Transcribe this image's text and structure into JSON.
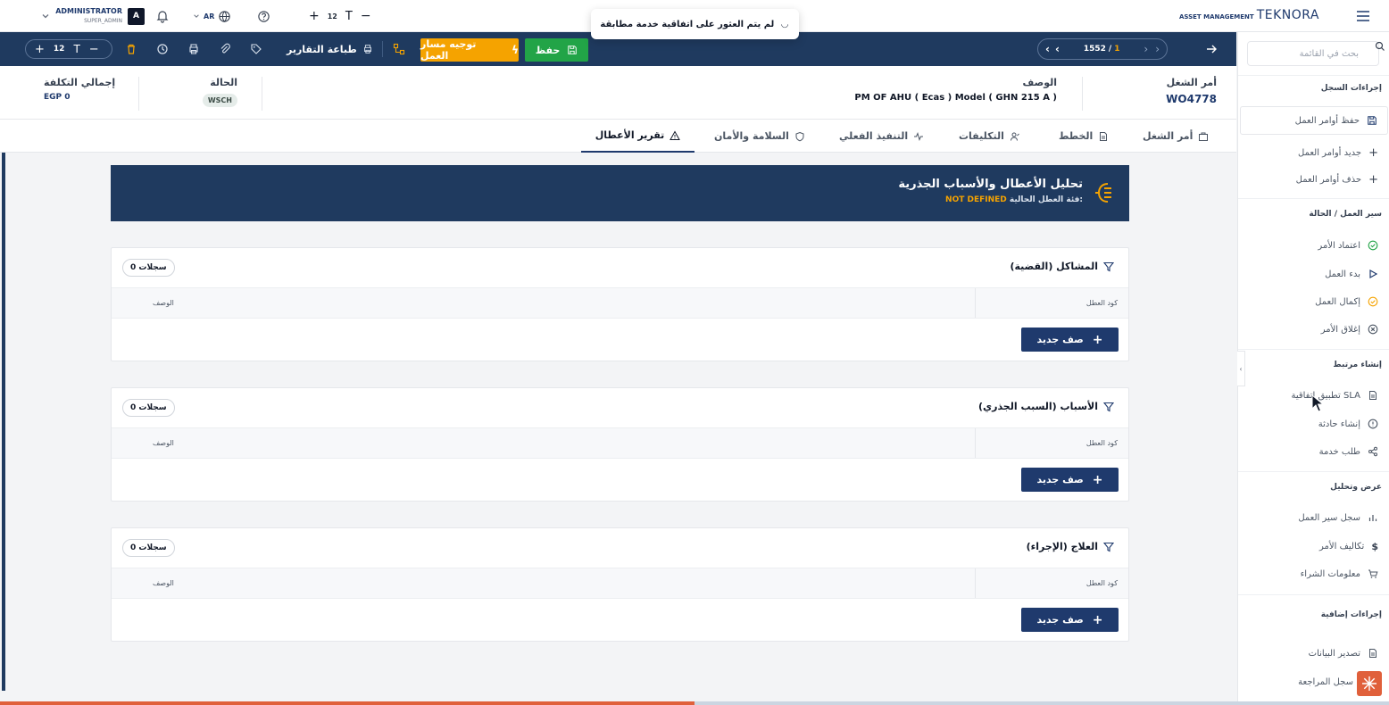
{
  "topbar": {
    "user_name": "ADMINISTRATOR",
    "user_role": "SUPER_ADMIN",
    "avatar_initial": "A",
    "lang": "AR",
    "font_size": "12",
    "logo_sub": "ASSET MANAGEMENT",
    "logo_main": "TEKNORA"
  },
  "toast": {
    "message": "لم يتم العثور على اتفاقية خدمة مطابقة"
  },
  "toolbar": {
    "font_size": "12",
    "print_reports": "طباعة التقارير",
    "route_work": "توجيه مسار العمل",
    "save": "حفظ",
    "pager_current": "1552",
    "pager_sep": "/",
    "pager_total": "1"
  },
  "header": {
    "wo_label": "أمر الشغل",
    "wo_value": "WO4778",
    "desc_label": "الوصف",
    "desc_value": "PM OF AHU  ( Ecas ) Model ( GHN 215 A )",
    "status_label": "الحالة",
    "status_value": "WSCH",
    "cost_label": "إجمالي التكلفة",
    "cost_value": "EGP 0"
  },
  "tabs": [
    {
      "label": "أمر الشغل"
    },
    {
      "label": "الخطط"
    },
    {
      "label": "التكليفات"
    },
    {
      "label": "التنفيذ الفعلي"
    },
    {
      "label": "السلامة والأمان"
    },
    {
      "label": "تقرير الأعطال"
    }
  ],
  "banner": {
    "title": "تحليل الأعطال والأسباب الجذرية",
    "sub_label": "فئة العطل الحالية:",
    "sub_value": "NOT DEFINED"
  },
  "cards": [
    {
      "title": "المشاكل (القضية)",
      "count": "0 سجلات",
      "col_code": "كود العطل",
      "col_desc": "الوصف",
      "add": "صف جديد"
    },
    {
      "title": "الأسباب (السبب الجذري)",
      "count": "0 سجلات",
      "col_code": "كود العطل",
      "col_desc": "الوصف",
      "add": "صف جديد"
    },
    {
      "title": "العلاج (الإجراء)",
      "count": "0 سجلات",
      "col_code": "كود العطل",
      "col_desc": "الوصف",
      "add": "صف جديد"
    }
  ],
  "sidebar": {
    "search_placeholder": "بحث في القائمة",
    "sections": {
      "record_actions": "إجراءات السجل",
      "workflow": "سير العمل / الحالة",
      "create_related": "إنشاء مرتبط",
      "view_analysis": "عرض وتحليل",
      "extra_actions": "إجراءات إضافية"
    },
    "items": {
      "save_wo": "حفظ أوامر العمل",
      "new_wo": "جديد أوامر العمل",
      "delete_wo": "حذف أوامر العمل",
      "approve": "اعتماد الأمر",
      "start": "بدء العمل",
      "complete": "إكمال العمل",
      "close": "إغلاق الأمر",
      "apply_sla": "تطبيق اتفاقية SLA",
      "create_incident": "إنشاء حادثة",
      "service_request": "طلب خدمة",
      "workflow_log": "سجل سير العمل",
      "order_costs": "تكاليف الأمر",
      "purchase_info": "معلومات الشراء",
      "export_data": "تصدير البيانات",
      "audit_log": "سجل المراجعة"
    }
  },
  "progress": {
    "fraction": 0.5
  },
  "colors": {
    "navy": "#1f3a5f",
    "save_green": "#22a447",
    "route_orange": "#f5a300",
    "accent": "#e0603b"
  }
}
